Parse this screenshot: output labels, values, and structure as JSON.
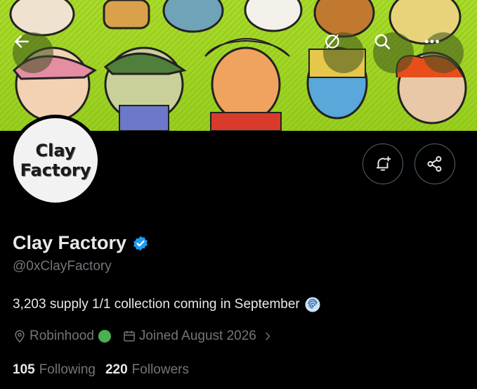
{
  "banner": {
    "background_color": "#a2d726",
    "scene": "illustrated-clay-characters"
  },
  "top_nav": {
    "back_icon": "arrow-left-icon",
    "tip_icon": "tip-icon",
    "search_icon": "search-icon",
    "more_icon": "more-icon"
  },
  "actions": {
    "notify_icon": "bell-plus-icon",
    "share_icon": "share-icon"
  },
  "avatar": {
    "text": "Clay\nFactory"
  },
  "profile": {
    "name": "Clay Factory",
    "verified": true,
    "verified_color": "#1d9bf0",
    "handle": "@0xClayFactory",
    "bio": "3,203 supply 1/1 collection coming in September",
    "bio_emoji": "fingerprint-emoji",
    "location": "Robinhood",
    "location_dot_color": "#4caf50",
    "joined": "Joined August 2026",
    "following_count": "105",
    "following_label": "Following",
    "followers_count": "220",
    "followers_label": "Followers"
  },
  "colors": {
    "background": "#000000",
    "text_primary": "#e7e9ea",
    "text_secondary": "#71767b",
    "border": "#536471"
  }
}
